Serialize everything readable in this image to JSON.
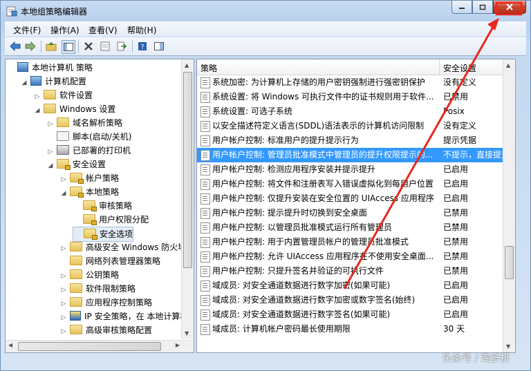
{
  "window": {
    "title": "本地组策略编辑器"
  },
  "menu": [
    "文件(F)",
    "操作(A)",
    "查看(V)",
    "帮助(H)"
  ],
  "tree": [
    {
      "label": "本地计算机 策略",
      "indent": 0,
      "toggle": "",
      "icon": "computer"
    },
    {
      "label": "计算机配置",
      "indent": 1,
      "toggle": "▲",
      "icon": "computer"
    },
    {
      "label": "软件设置",
      "indent": 2,
      "toggle": "▷",
      "icon": "folder"
    },
    {
      "label": "Windows 设置",
      "indent": 2,
      "toggle": "▲",
      "icon": "folder"
    },
    {
      "label": "域名解析策略",
      "indent": 3,
      "toggle": "▷",
      "icon": "folder"
    },
    {
      "label": "脚本(启动/关机)",
      "indent": 3,
      "toggle": "",
      "icon": "script"
    },
    {
      "label": "已部署的打印机",
      "indent": 3,
      "toggle": "▷",
      "icon": "printer"
    },
    {
      "label": "安全设置",
      "indent": 3,
      "toggle": "▲",
      "icon": "security"
    },
    {
      "label": "帐户策略",
      "indent": 4,
      "toggle": "▷",
      "icon": "folder-lock"
    },
    {
      "label": "本地策略",
      "indent": 4,
      "toggle": "▲",
      "icon": "folder-lock"
    },
    {
      "label": "审核策略",
      "indent": 5,
      "toggle": "",
      "icon": "folder-lock"
    },
    {
      "label": "用户权限分配",
      "indent": 5,
      "toggle": "",
      "icon": "folder-lock"
    },
    {
      "label": "安全选项",
      "indent": 5,
      "toggle": "",
      "icon": "folder-lock",
      "selected": true
    },
    {
      "label": "高级安全 Windows 防火墙",
      "indent": 4,
      "toggle": "▷",
      "icon": "folder"
    },
    {
      "label": "网络列表管理器策略",
      "indent": 4,
      "toggle": "",
      "icon": "folder"
    },
    {
      "label": "公钥策略",
      "indent": 4,
      "toggle": "▷",
      "icon": "folder"
    },
    {
      "label": "软件限制策略",
      "indent": 4,
      "toggle": "▷",
      "icon": "folder"
    },
    {
      "label": "应用程序控制策略",
      "indent": 4,
      "toggle": "▷",
      "icon": "folder"
    },
    {
      "label": "IP 安全策略，在 本地计算机",
      "indent": 4,
      "toggle": "▷",
      "icon": "ipsec"
    },
    {
      "label": "高级审核策略配置",
      "indent": 4,
      "toggle": "▷",
      "icon": "folder"
    }
  ],
  "list": {
    "columns": {
      "policy": "策略",
      "setting": "安全设置"
    },
    "rows": [
      {
        "policy": "系统加密: 为计算机上存储的用户密钥强制进行强密钥保护",
        "setting": "没有定义"
      },
      {
        "policy": "系统设置: 将 Windows 可执行文件中的证书规则用于软件...",
        "setting": "已禁用"
      },
      {
        "policy": "系统设置: 可选子系统",
        "setting": "Posix"
      },
      {
        "policy": "以安全描述符定义语言(SDDL)语法表示的计算机访问限制",
        "setting": "没有定义"
      },
      {
        "policy": "用户帐户控制: 标准用户的提升提示行为",
        "setting": "提示凭据"
      },
      {
        "policy": "用户帐户控制: 管理员批准模式中管理员的提升权限提示的...",
        "setting": "不提示，直接提升",
        "selected": true
      },
      {
        "policy": "用户帐户控制: 检测应用程序安装并提示提升",
        "setting": "已启用"
      },
      {
        "policy": "用户帐户控制: 将文件和注册表写入错误虚拟化到每用户位置",
        "setting": "已启用"
      },
      {
        "policy": "用户帐户控制: 仅提升安装在安全位置的 UIAccess 应用程序",
        "setting": "已启用"
      },
      {
        "policy": "用户帐户控制: 提示提升时切换到安全桌面",
        "setting": "已禁用"
      },
      {
        "policy": "用户帐户控制: 以管理员批准模式运行所有管理员",
        "setting": "已禁用"
      },
      {
        "policy": "用户帐户控制: 用于内置管理员帐户的管理员批准模式",
        "setting": "已禁用"
      },
      {
        "policy": "用户帐户控制: 允许 UIAccess 应用程序在不使用安全桌面...",
        "setting": "已禁用"
      },
      {
        "policy": "用户帐户控制: 只提升签名并验证的可执行文件",
        "setting": "已禁用"
      },
      {
        "policy": "域成员: 对安全通道数据进行数字加密(如果可能)",
        "setting": "已启用"
      },
      {
        "policy": "域成员: 对安全通道数据进行数字加密或数字签名(始终)",
        "setting": "已启用"
      },
      {
        "policy": "域成员: 对安全通道数据进行数字签名(如果可能)",
        "setting": "已启用"
      },
      {
        "policy": "域成员: 计算机帐户密码最长使用期限",
        "setting": "30 天"
      }
    ]
  },
  "watermark": "头条号 / 淘多折",
  "colors": {
    "selection": "#3399ff",
    "annotation": "#e8281e",
    "close": "#c7432b"
  }
}
